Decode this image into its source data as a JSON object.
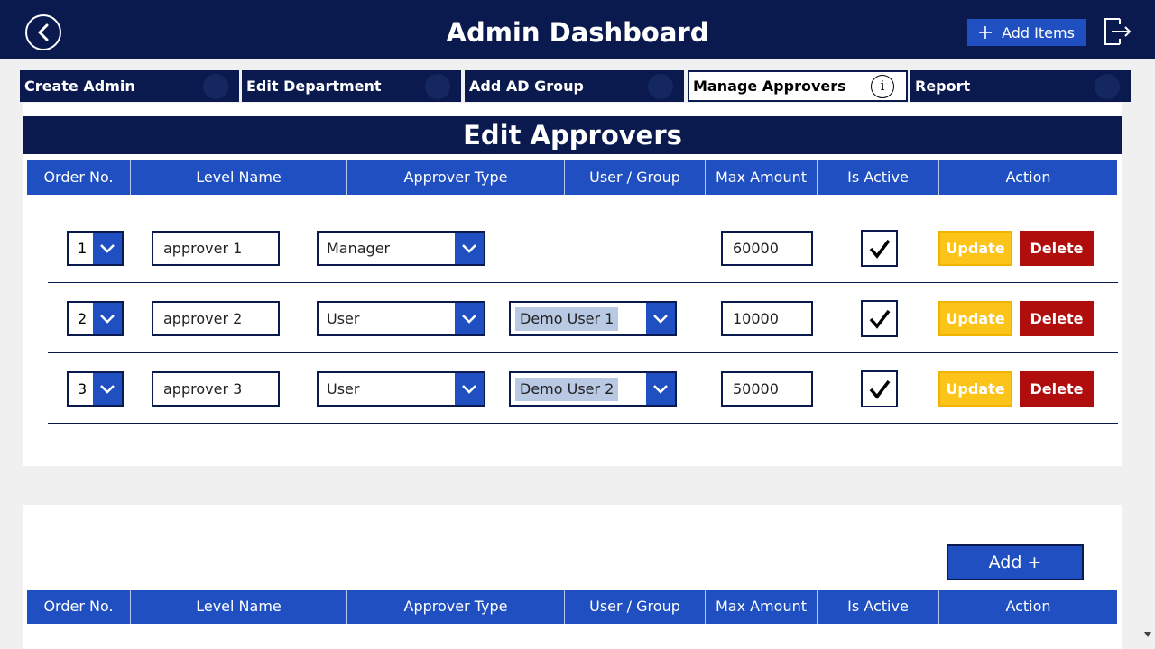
{
  "header": {
    "title": "Admin Dashboard",
    "add_items_label": "Add Items"
  },
  "tabs": [
    {
      "label": "Create Admin"
    },
    {
      "label": "Edit Department"
    },
    {
      "label": "Add AD Group"
    },
    {
      "label": "Manage Approvers"
    },
    {
      "label": "Report"
    }
  ],
  "section_title": "Edit Approvers",
  "table_headers": [
    "Order No.",
    "Level Name",
    "Approver Type",
    "User / Group",
    "Max Amount",
    "Is Active",
    "Action"
  ],
  "rows": [
    {
      "order": "1",
      "level_name": "approver 1",
      "approver_type": "Manager",
      "user_group": "",
      "max_amount": "60000",
      "is_active": true,
      "update_label": "Update",
      "delete_label": "Delete"
    },
    {
      "order": "2",
      "level_name": "approver 2",
      "approver_type": "User",
      "user_group": "Demo User 1",
      "max_amount": "10000",
      "is_active": true,
      "update_label": "Update",
      "delete_label": "Delete"
    },
    {
      "order": "3",
      "level_name": "approver 3",
      "approver_type": "User",
      "user_group": "Demo User 2",
      "max_amount": "50000",
      "is_active": true,
      "update_label": "Update",
      "delete_label": "Delete"
    }
  ],
  "add_button_label": "Add +",
  "bottom_table_headers": [
    "Order No.",
    "Level Name",
    "Approver Type",
    "User / Group",
    "Max Amount",
    "Is Active",
    "Action"
  ],
  "colors": {
    "navy": "#0a1a4e",
    "blue": "#1f4fc1",
    "update_yellow": "#fcc419",
    "delete_red": "#b00d0d"
  }
}
